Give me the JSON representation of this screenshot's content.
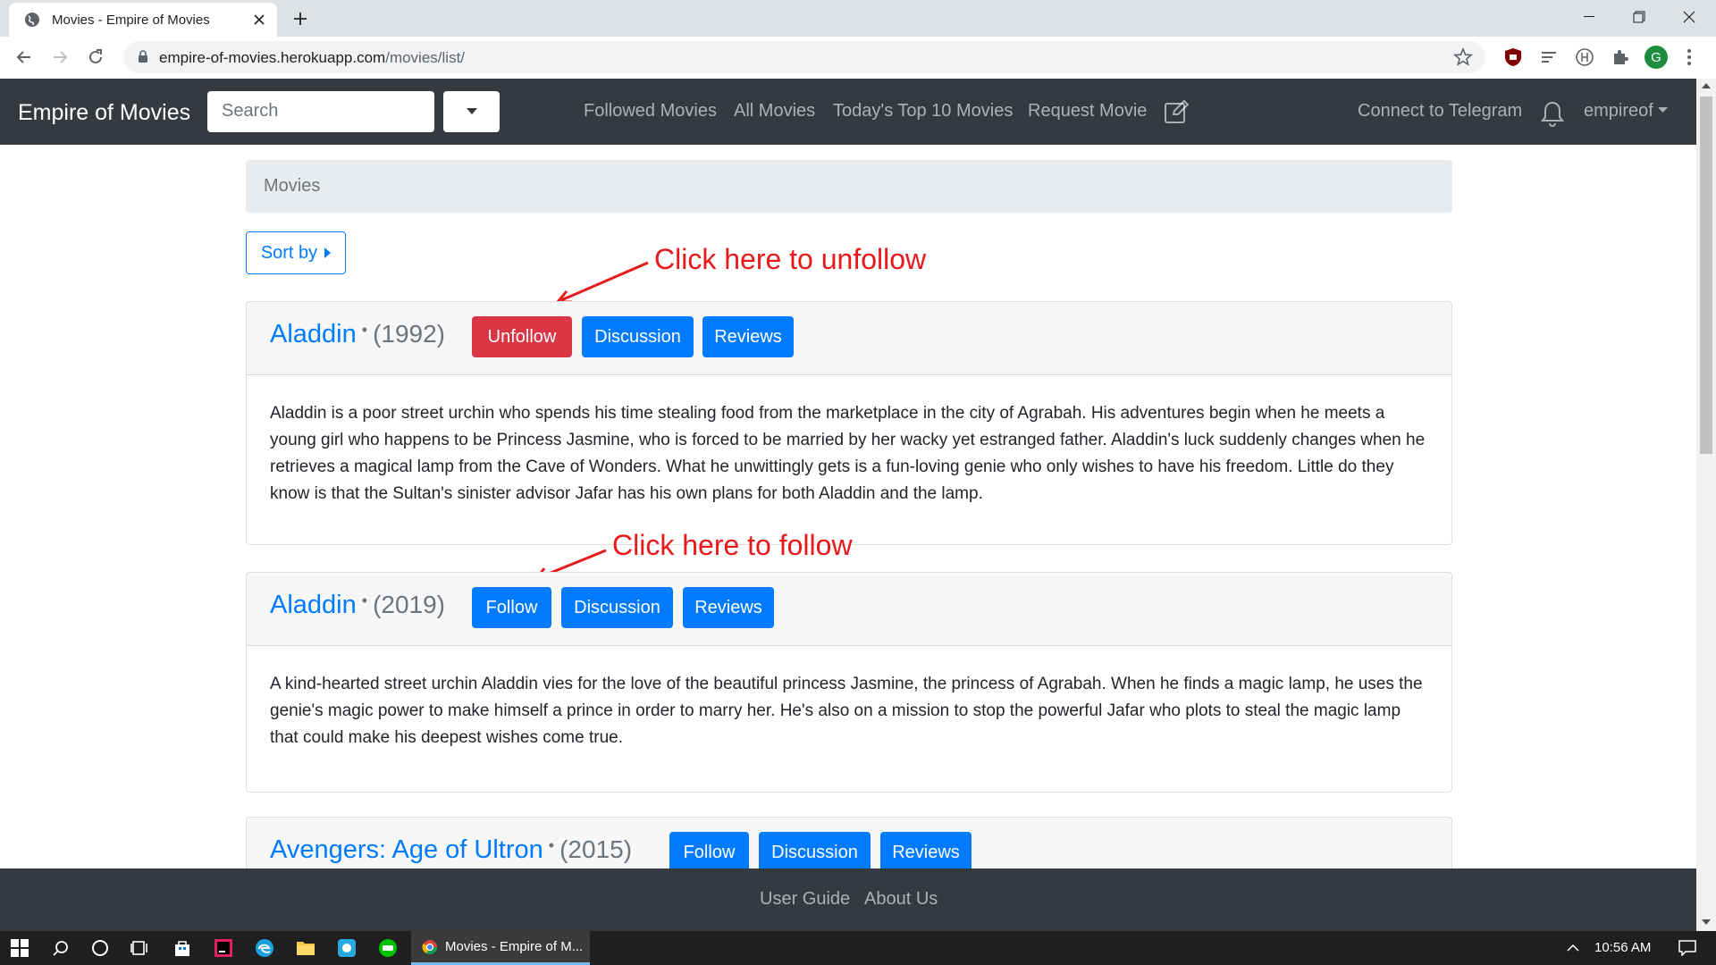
{
  "browser": {
    "tab_title": "Movies - Empire of Movies",
    "url_host": "empire-of-movies.herokuapp.com",
    "url_path": "/movies/list/",
    "profile_initial": "G"
  },
  "navbar": {
    "brand": "Empire of Movies",
    "search_placeholder": "Search",
    "links": {
      "followed": "Followed Movies",
      "all": "All Movies",
      "top10": "Today's Top 10 Movies",
      "request": "Request Movie",
      "telegram": "Connect to Telegram"
    },
    "user": "empireof"
  },
  "breadcrumb": "Movies",
  "sort_label": "Sort by",
  "movies": [
    {
      "title": "Aladdin",
      "year": "(1992)",
      "follow_label": "Unfollow",
      "discussion_label": "Discussion",
      "reviews_label": "Reviews",
      "description": "Aladdin is a poor street urchin who spends his time stealing food from the marketplace in the city of Agrabah. His adventures begin when he meets a young girl who happens to be Princess Jasmine, who is forced to be married by her wacky yet estranged father. Aladdin's luck suddenly changes when he retrieves a magical lamp from the Cave of Wonders. What he unwittingly gets is a fun-loving genie who only wishes to have his freedom. Little do they know is that the Sultan's sinister advisor Jafar has his own plans for both Aladdin and the lamp."
    },
    {
      "title": "Aladdin",
      "year": "(2019)",
      "follow_label": "Follow",
      "discussion_label": "Discussion",
      "reviews_label": "Reviews",
      "description": "A kind-hearted street urchin Aladdin vies for the love of the beautiful princess Jasmine, the princess of Agrabah. When he finds a magic lamp, he uses the genie's magic power to make himself a prince in order to marry her. He's also on a mission to stop the powerful Jafar who plots to steal the magic lamp that could make his deepest wishes come true."
    },
    {
      "title": "Avengers: Age of Ultron",
      "year": "(2015)",
      "follow_label": "Follow",
      "discussion_label": "Discussion",
      "reviews_label": "Reviews"
    }
  ],
  "annotations": {
    "unfollow": "Click here to unfollow",
    "follow": "Click here to follow"
  },
  "footer": {
    "user_guide": "User Guide",
    "about": "About Us"
  },
  "taskbar": {
    "app_label": "Movies - Empire of M...",
    "time": "10:56 AM"
  },
  "colors": {
    "primary": "#007bff",
    "danger": "#dc3545",
    "navbar": "#343a40",
    "annotation": "#e8191b"
  }
}
